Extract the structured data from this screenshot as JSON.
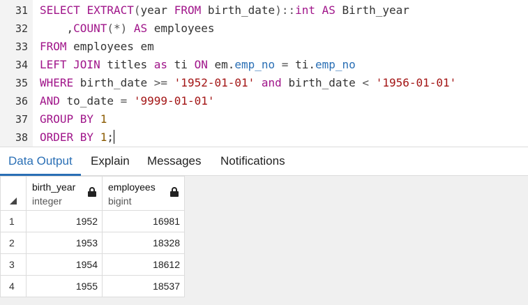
{
  "editor": {
    "lines": [
      {
        "num": "31",
        "tokens": [
          {
            "c": "kw",
            "t": "SELECT "
          },
          {
            "c": "fn",
            "t": "EXTRACT"
          },
          {
            "c": "op",
            "t": "("
          },
          {
            "c": "pl",
            "t": "year "
          },
          {
            "c": "kw",
            "t": "FROM"
          },
          {
            "c": "pl",
            "t": " birth_date"
          },
          {
            "c": "op",
            "t": ")::"
          },
          {
            "c": "ty",
            "t": "int"
          },
          {
            "c": "pl",
            "t": " "
          },
          {
            "c": "kw",
            "t": "AS"
          },
          {
            "c": "pl",
            "t": " Birth_year"
          }
        ]
      },
      {
        "num": "32",
        "tokens": [
          {
            "c": "pl",
            "t": "    ,"
          },
          {
            "c": "fn",
            "t": "COUNT"
          },
          {
            "c": "op",
            "t": "(*)"
          },
          {
            "c": "pl",
            "t": " "
          },
          {
            "c": "kw",
            "t": "AS"
          },
          {
            "c": "pl",
            "t": " employees"
          }
        ]
      },
      {
        "num": "33",
        "tokens": [
          {
            "c": "kw",
            "t": "FROM"
          },
          {
            "c": "pl",
            "t": " employees em"
          }
        ]
      },
      {
        "num": "34",
        "tokens": [
          {
            "c": "kw",
            "t": "LEFT JOIN"
          },
          {
            "c": "pl",
            "t": " titles "
          },
          {
            "c": "kw",
            "t": "as"
          },
          {
            "c": "pl",
            "t": " ti "
          },
          {
            "c": "kw",
            "t": "ON"
          },
          {
            "c": "pl",
            "t": " em."
          },
          {
            "c": "pr",
            "t": "emp_no"
          },
          {
            "c": "op",
            "t": " = "
          },
          {
            "c": "pl",
            "t": "ti."
          },
          {
            "c": "pr",
            "t": "emp_no"
          }
        ]
      },
      {
        "num": "35",
        "tokens": [
          {
            "c": "kw",
            "t": "WHERE"
          },
          {
            "c": "pl",
            "t": " birth_date "
          },
          {
            "c": "op",
            "t": ">="
          },
          {
            "c": "pl",
            "t": " "
          },
          {
            "c": "st",
            "t": "'1952-01-01'"
          },
          {
            "c": "pl",
            "t": " "
          },
          {
            "c": "kw",
            "t": "and"
          },
          {
            "c": "pl",
            "t": " birth_date "
          },
          {
            "c": "op",
            "t": "<"
          },
          {
            "c": "pl",
            "t": " "
          },
          {
            "c": "st",
            "t": "'1956-01-01'"
          }
        ]
      },
      {
        "num": "36",
        "tokens": [
          {
            "c": "kw",
            "t": "AND"
          },
          {
            "c": "pl",
            "t": " to_date "
          },
          {
            "c": "op",
            "t": "="
          },
          {
            "c": "pl",
            "t": " "
          },
          {
            "c": "st",
            "t": "'9999-01-01'"
          }
        ]
      },
      {
        "num": "37",
        "tokens": [
          {
            "c": "kw",
            "t": "GROUP BY"
          },
          {
            "c": "pl",
            "t": " "
          },
          {
            "c": "nu",
            "t": "1"
          }
        ]
      },
      {
        "num": "38",
        "tokens": [
          {
            "c": "kw",
            "t": "ORDER BY"
          },
          {
            "c": "pl",
            "t": " "
          },
          {
            "c": "nu",
            "t": "1"
          },
          {
            "c": "pl",
            "t": ";"
          }
        ],
        "cursor": true
      }
    ]
  },
  "tabs": [
    {
      "label": "Data Output",
      "active": true
    },
    {
      "label": "Explain",
      "active": false
    },
    {
      "label": "Messages",
      "active": false
    },
    {
      "label": "Notifications",
      "active": false
    }
  ],
  "grid": {
    "columns": [
      {
        "name": "birth_year",
        "type": "integer"
      },
      {
        "name": "employees",
        "type": "bigint"
      }
    ],
    "rows": [
      {
        "num": "1",
        "cells": [
          "1952",
          "16981"
        ]
      },
      {
        "num": "2",
        "cells": [
          "1953",
          "18328"
        ]
      },
      {
        "num": "3",
        "cells": [
          "1954",
          "18612"
        ]
      },
      {
        "num": "4",
        "cells": [
          "1955",
          "18537"
        ]
      }
    ]
  },
  "colors": {
    "keyword": "#a0158a",
    "string": "#a31515",
    "number": "#8a5a00",
    "property": "#2a6fb5",
    "accent": "#2a6fb5"
  },
  "icons": {
    "column_lock": "lock-icon",
    "corner": "select-all-triangle-icon"
  }
}
